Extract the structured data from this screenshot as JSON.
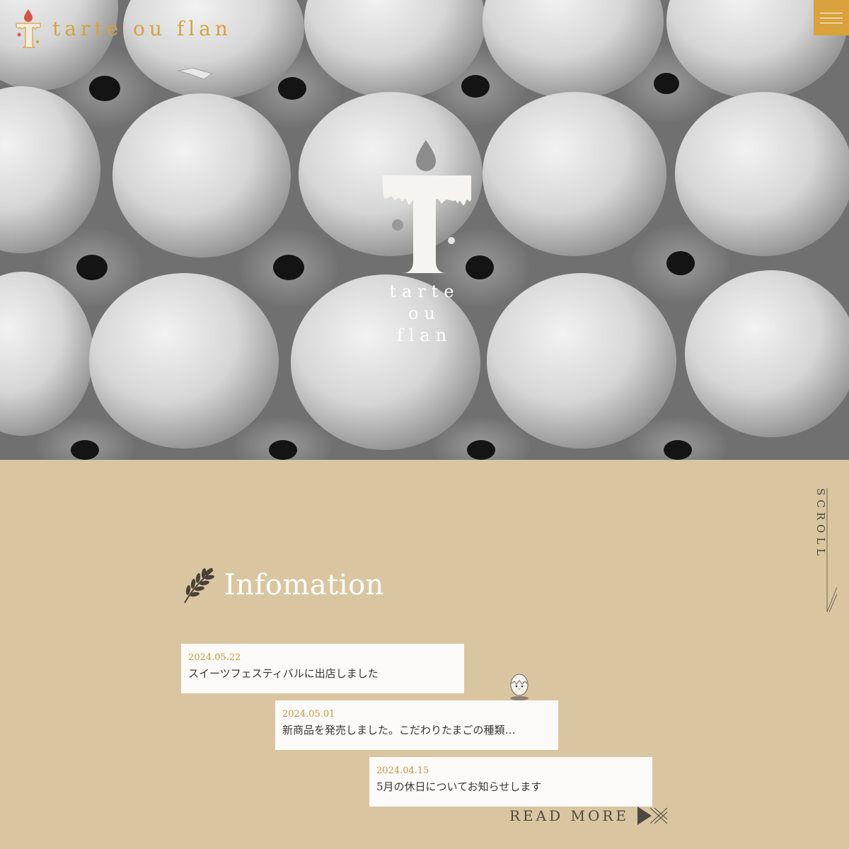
{
  "header": {
    "brand_name": "tarte ou flan",
    "logo_icon": "tart-t-logo-icon",
    "menu_icon": "hamburger-menu-icon",
    "accent_color": "#d9a23c"
  },
  "hero": {
    "logo_lines": [
      "tarte",
      "ou",
      "flan"
    ],
    "logo_icon": "tart-t-logo-icon"
  },
  "scroll": {
    "label": "SCROLL"
  },
  "information": {
    "title": "Infomation",
    "icon": "wheat-icon",
    "items": [
      {
        "date": "2024.05.22",
        "text": "スイーツフェスティバルに出店しました"
      },
      {
        "date": "2024.05.01",
        "text": "新商品を発売しました。こだわりたまごの種類…"
      },
      {
        "date": "2024.04.15",
        "text": "5月の休日についてお知らせします"
      }
    ],
    "read_more": "READ MORE",
    "mascot_icon": "egg-chick-icon"
  },
  "colors": {
    "background": "#d9c6a0",
    "date": "#c8973a",
    "card": "#fbfaf8"
  }
}
